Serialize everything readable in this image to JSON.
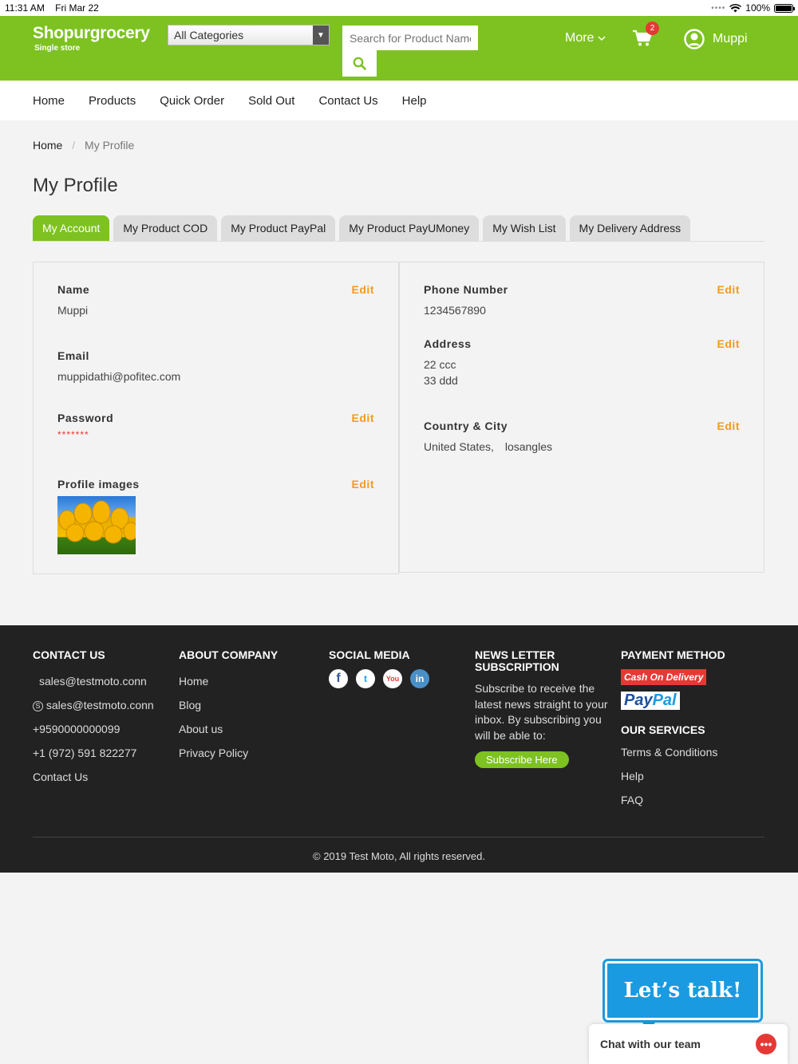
{
  "status_bar": {
    "time": "11:31 AM",
    "date": "Fri Mar 22",
    "battery": "100%"
  },
  "header": {
    "brand": "Shopurgrocery",
    "brand_sub": "Single store",
    "category_select": "All Categories",
    "search_placeholder": "Search for Product Name",
    "more_label": "More",
    "cart_count": "2",
    "user_name": "Muppi",
    "accent_color": "#7dc221"
  },
  "nav": {
    "items": [
      "Home",
      "Products",
      "Quick Order",
      "Sold Out",
      "Contact Us",
      "Help"
    ]
  },
  "breadcrumb": {
    "home": "Home",
    "current": "My Profile"
  },
  "page_title": "My Profile",
  "tabs": [
    {
      "label": "My Account",
      "active": true
    },
    {
      "label": "My Product COD"
    },
    {
      "label": "My Product PayPal"
    },
    {
      "label": "My Product PayUMoney"
    },
    {
      "label": "My Wish List"
    },
    {
      "label": "My Delivery Address"
    }
  ],
  "profile": {
    "edit_label": "Edit",
    "name_label": "Name",
    "name_value": "Muppi",
    "email_label": "Email",
    "email_value": "muppidathi@pofitec.com",
    "password_label": "Password",
    "password_value": "*******",
    "images_label": "Profile images",
    "phone_label": "Phone Number",
    "phone_value": "1234567890",
    "address_label": "Address",
    "address_line1": "22 ccc",
    "address_line2": "33 ddd",
    "country_city_label": "Country & City",
    "country_value": "United States,",
    "city_value": "losangles"
  },
  "footer": {
    "contact": {
      "title": "CONTACT US",
      "email1": "sales@testmoto.conn",
      "email2": "sales@testmoto.conn",
      "phone1": "+9590000000099",
      "phone2": "+1 (972) 591 822277",
      "link": "Contact Us"
    },
    "about": {
      "title": "ABOUT COMPANY",
      "items": [
        "Home",
        "Blog",
        "About us",
        "Privacy Policy"
      ]
    },
    "social": {
      "title": "SOCIAL MEDIA",
      "icons": [
        "facebook-icon",
        "twitter-icon",
        "youtube-icon",
        "linkedin-icon"
      ]
    },
    "newsletter": {
      "title": "NEWS LETTER SUBSCRIPTION",
      "text": "Subscribe to receive the latest news straight to your inbox. By subscribing you will be able to:",
      "button": "Subscribe Here"
    },
    "payment": {
      "title": "PAYMENT METHOD",
      "cod": "Cash On Delivery",
      "paypal_pay": "Pay",
      "paypal_pal": "Pal"
    },
    "services": {
      "title": "OUR SERVICES",
      "items": [
        "Terms & Conditions",
        "Help",
        "FAQ"
      ]
    },
    "copyright": "© 2019 Test Moto, All rights reserved."
  },
  "chat": {
    "bubble": "Let’s talk!",
    "bar_label": "Chat with our team"
  }
}
